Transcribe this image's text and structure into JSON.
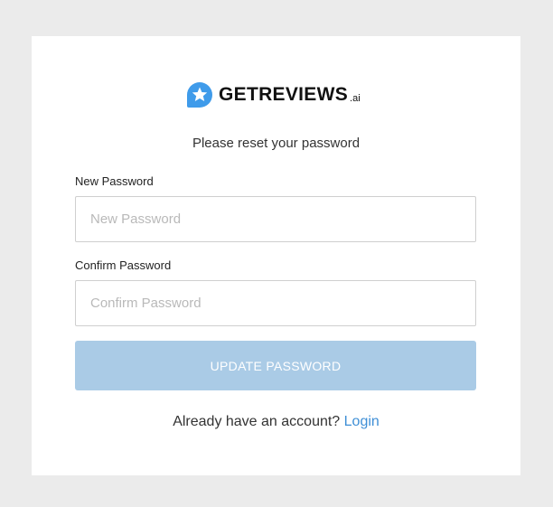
{
  "brand": {
    "name": "GETREVIEWS",
    "suffix": ".ai",
    "icon": "star-chat-bubble-icon",
    "color": "#3f9bea"
  },
  "form": {
    "subtitle": "Please reset your password",
    "new_password": {
      "label": "New Password",
      "placeholder": "New Password",
      "value": ""
    },
    "confirm_password": {
      "label": "Confirm Password",
      "placeholder": "Confirm Password",
      "value": ""
    },
    "submit_label": "UPDATE PASSWORD",
    "submit_color": "#aacbe6"
  },
  "footer": {
    "prompt": "Already have an account?",
    "link_label": "Login",
    "link_color": "#3f8fd6"
  }
}
